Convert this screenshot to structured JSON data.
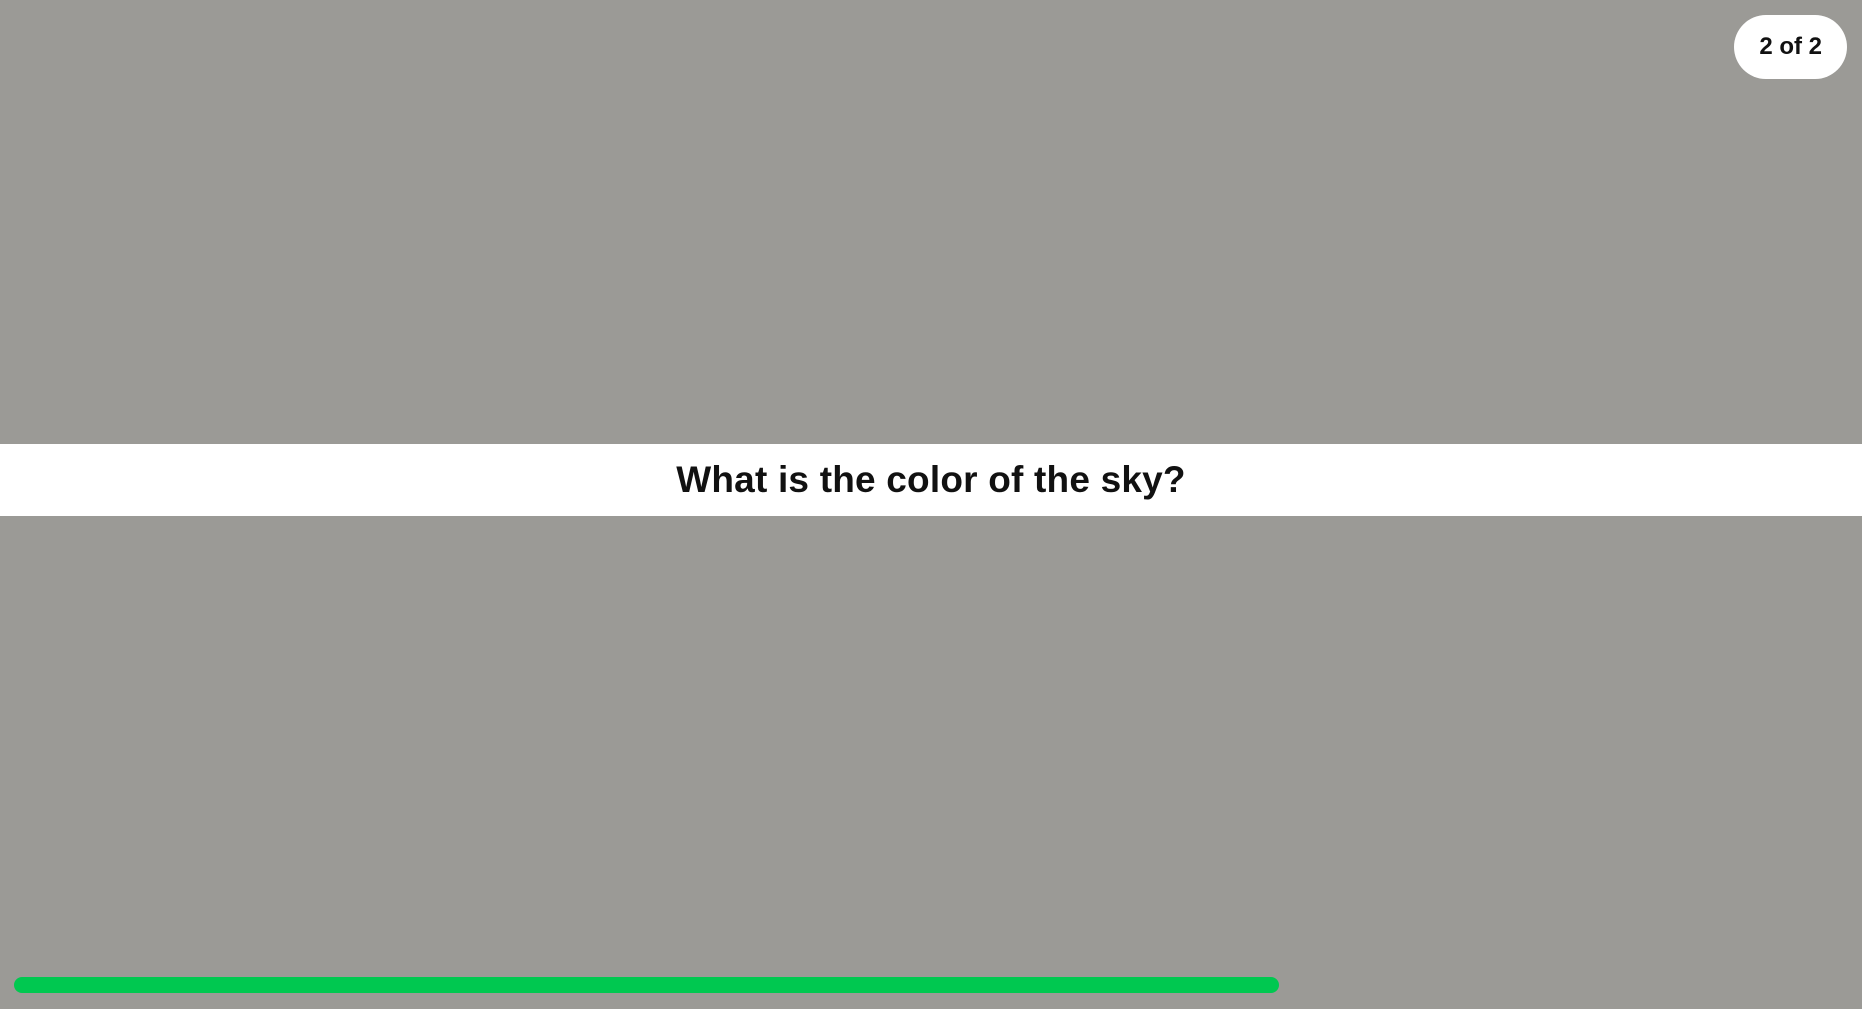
{
  "counter": {
    "label": "2 of 2"
  },
  "question": {
    "text": "What is the color of the sky?"
  },
  "progress": {
    "fraction": 0.69
  },
  "colors": {
    "background": "#9b9a96",
    "band": "#ffffff",
    "progress": "#00c850",
    "text": "#111111"
  }
}
